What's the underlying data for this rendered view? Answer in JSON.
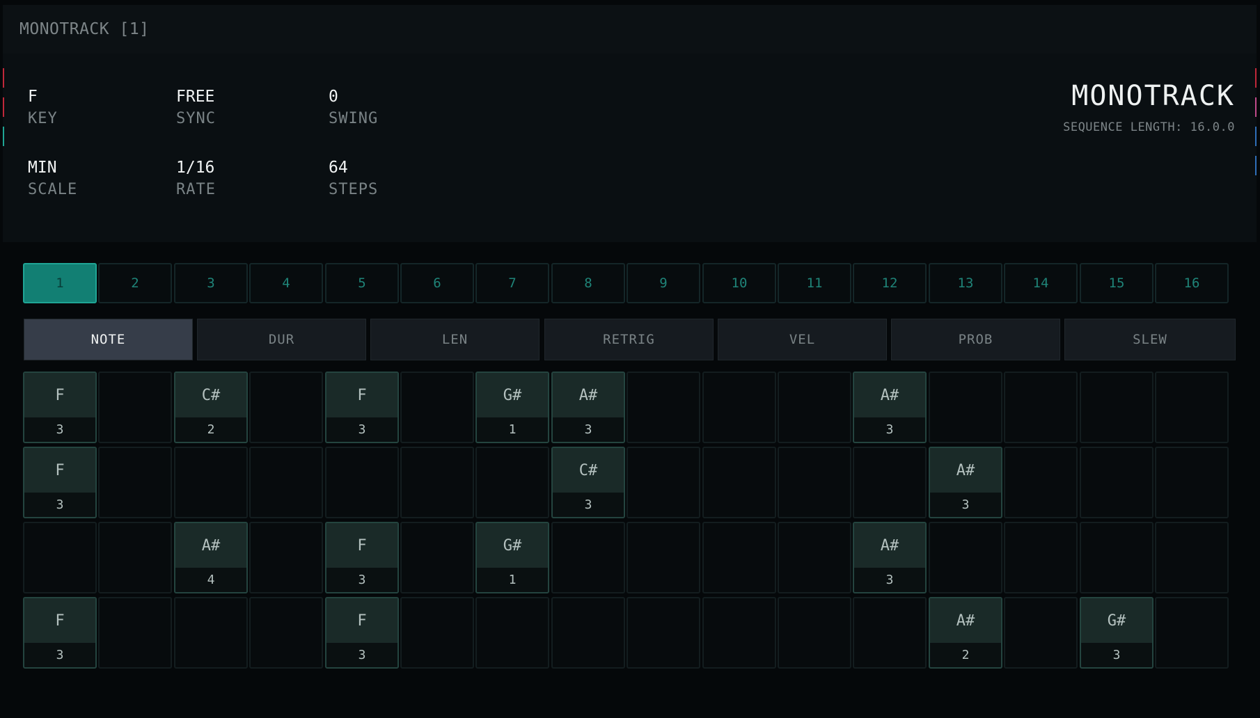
{
  "window": {
    "title": "MONOTRACK [1]"
  },
  "params": {
    "key": {
      "value": "F",
      "label": "KEY"
    },
    "sync": {
      "value": "FREE",
      "label": "SYNC"
    },
    "swing": {
      "value": "0",
      "label": "SWING"
    },
    "scale": {
      "value": "MIN",
      "label": "SCALE"
    },
    "rate": {
      "value": "1/16",
      "label": "RATE"
    },
    "steps": {
      "value": "64",
      "label": "STEPS"
    }
  },
  "brand": {
    "name": "MONOTRACK",
    "sequence_length": "SEQUENCE LENGTH: 16.0.0"
  },
  "edge_markers": {
    "left": [
      "#c0283a",
      "#c0283a",
      "#1fa595"
    ],
    "right": [
      "#c0283a",
      "#c04a8a",
      "#2f6fb8",
      "#2f6fb8"
    ]
  },
  "pages": {
    "active": "1",
    "labels": [
      "1",
      "2",
      "3",
      "4",
      "5",
      "6",
      "7",
      "8",
      "9",
      "10",
      "11",
      "12",
      "13",
      "14",
      "15",
      "16"
    ]
  },
  "modes": {
    "active": "NOTE",
    "labels": [
      "NOTE",
      "DUR",
      "LEN",
      "RETRIG",
      "VEL",
      "PROB",
      "SLEW"
    ]
  },
  "steps": [
    [
      {
        "n": "F",
        "o": "3"
      },
      null,
      {
        "n": "C#",
        "o": "2"
      },
      null,
      {
        "n": "F",
        "o": "3"
      },
      null,
      {
        "n": "G#",
        "o": "1"
      },
      {
        "n": "A#",
        "o": "3"
      },
      null,
      null,
      null,
      {
        "n": "A#",
        "o": "3"
      },
      null,
      null,
      null,
      null
    ],
    [
      {
        "n": "F",
        "o": "3"
      },
      null,
      null,
      null,
      null,
      null,
      null,
      {
        "n": "C#",
        "o": "3"
      },
      null,
      null,
      null,
      null,
      {
        "n": "A#",
        "o": "3"
      },
      null,
      null,
      null
    ],
    [
      null,
      null,
      {
        "n": "A#",
        "o": "4"
      },
      null,
      {
        "n": "F",
        "o": "3"
      },
      null,
      {
        "n": "G#",
        "o": "1"
      },
      null,
      null,
      null,
      null,
      {
        "n": "A#",
        "o": "3"
      },
      null,
      null,
      null,
      null
    ],
    [
      {
        "n": "F",
        "o": "3"
      },
      null,
      null,
      null,
      {
        "n": "F",
        "o": "3"
      },
      null,
      null,
      null,
      null,
      null,
      null,
      null,
      {
        "n": "A#",
        "o": "2"
      },
      null,
      {
        "n": "G#",
        "o": "3"
      },
      null
    ]
  ],
  "colors": {
    "accent": "#127f73",
    "mode_active": "#363d49",
    "note_fill": "#1a2a28"
  }
}
